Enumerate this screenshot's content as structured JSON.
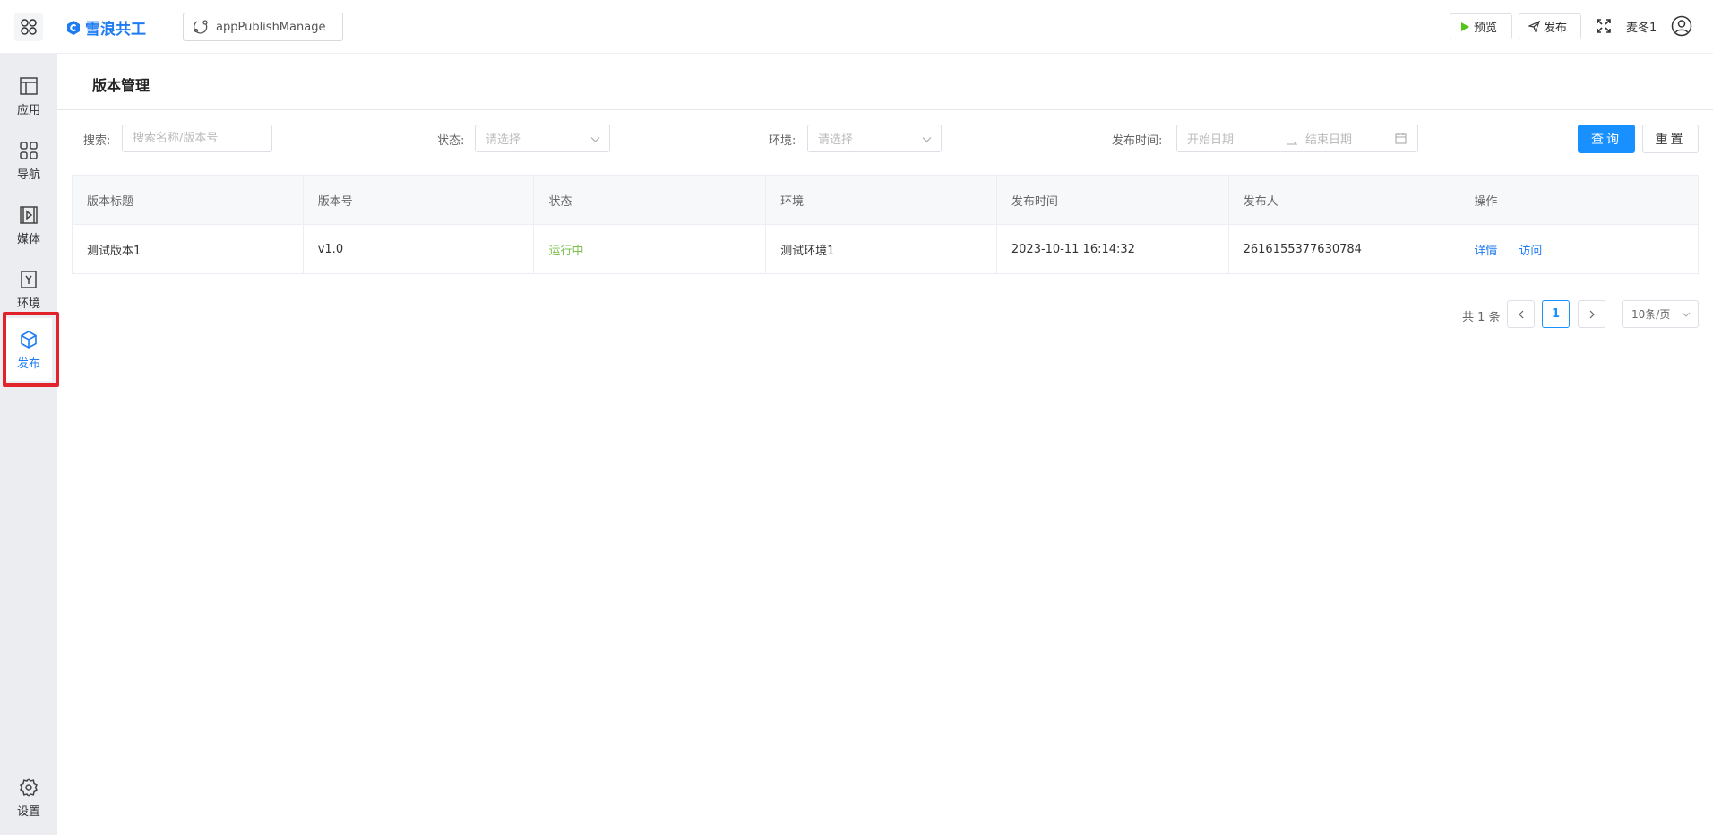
{
  "header": {
    "logo_text": "雪浪共工",
    "project_name": "appPublishManage",
    "preview_label": "预览",
    "publish_label": "发布",
    "user_name": "麦冬1"
  },
  "sidebar": {
    "items": [
      {
        "label": "应用",
        "icon": "layout-icon"
      },
      {
        "label": "导航",
        "icon": "grid-icon"
      },
      {
        "label": "媒体",
        "icon": "media-icon"
      },
      {
        "label": "环境",
        "icon": "environment-icon"
      },
      {
        "label": "发布",
        "icon": "cube-icon",
        "active": true
      }
    ],
    "settings_label": "设置"
  },
  "page": {
    "title": "版本管理"
  },
  "filters": {
    "search_label": "搜索:",
    "search_placeholder": "搜索名称/版本号",
    "status_label": "状态:",
    "status_placeholder": "请选择",
    "env_label": "环境:",
    "env_placeholder": "请选择",
    "time_label": "发布时间:",
    "start_placeholder": "开始日期",
    "end_placeholder": "结束日期",
    "query_label": "查询",
    "reset_label": "重置"
  },
  "table": {
    "headers": [
      "版本标题",
      "版本号",
      "状态",
      "环境",
      "发布时间",
      "发布人",
      "操作"
    ],
    "rows": [
      {
        "title": "测试版本1",
        "version": "v1.0",
        "status": "运行中",
        "env": "测试环境1",
        "time": "2023-10-11 16:14:32",
        "publisher": "2616155377630784",
        "actions": [
          "详情",
          "访问"
        ]
      }
    ]
  },
  "pagination": {
    "total": "共 1 条",
    "current": "1",
    "page_size": "10条/页"
  },
  "colors": {
    "accent": "#1890ff",
    "brand": "#1e7bf2",
    "status_running": "#7ec050",
    "highlight": "#e3232c"
  }
}
